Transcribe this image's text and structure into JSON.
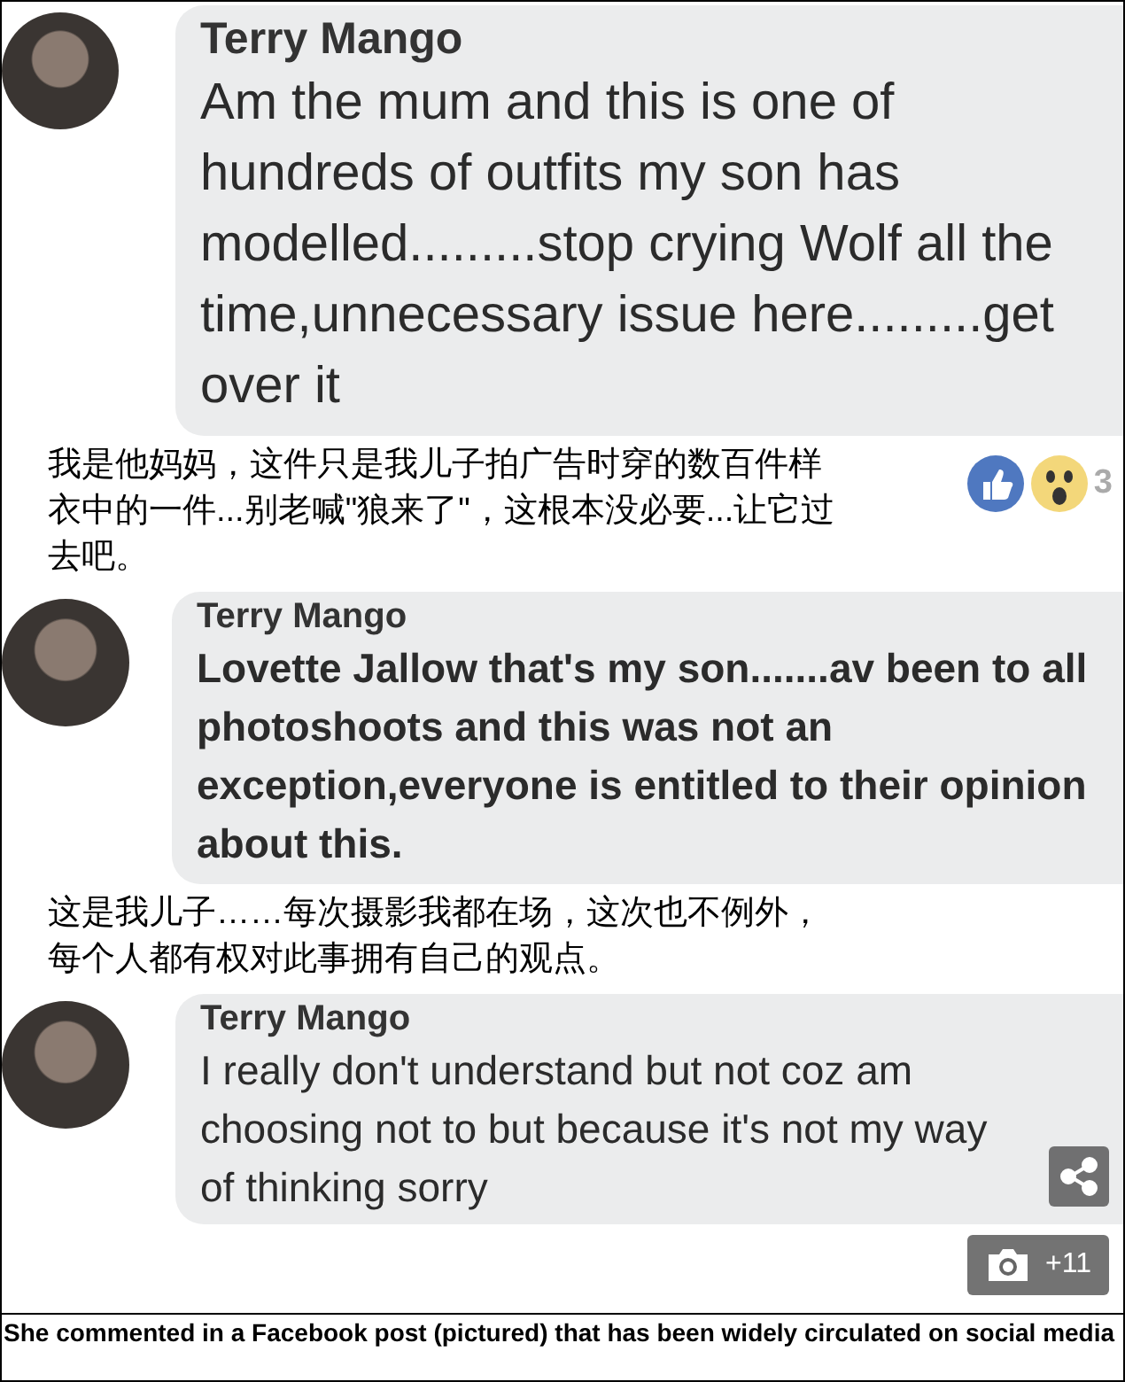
{
  "thread": [
    {
      "kind": "comment",
      "name": "Terry Mango",
      "text": "Am the mum and this is one of hundreds of outfits my son has modelled.........stop crying Wolf all the time,unnecessary issue here.........get over it"
    },
    {
      "kind": "translation",
      "text": "我是他妈妈，这件只是我儿子拍广告时穿的数百件样衣中的一件...别老喊\"狼来了\"，这根本没必要...让它过去吧。",
      "reactions": {
        "count": "3"
      }
    },
    {
      "kind": "comment",
      "name": "Terry Mango",
      "text": "Lovette Jallow that's my son.......av been to all photoshoots and this was not an exception,everyone is entitled to their opinion about this."
    },
    {
      "kind": "translation",
      "text": "这是我儿子……每次摄影我都在场，这次也不例外，每个人都有权对此事拥有自己的观点。"
    },
    {
      "kind": "comment",
      "name": "Terry Mango",
      "text": "I really don't understand but not coz am choosing not to but because it's not my way of thinking sorry"
    }
  ],
  "gallery_badge": "+11",
  "caption": "She commented in a Facebook post (pictured) that has been widely circulated on social media"
}
